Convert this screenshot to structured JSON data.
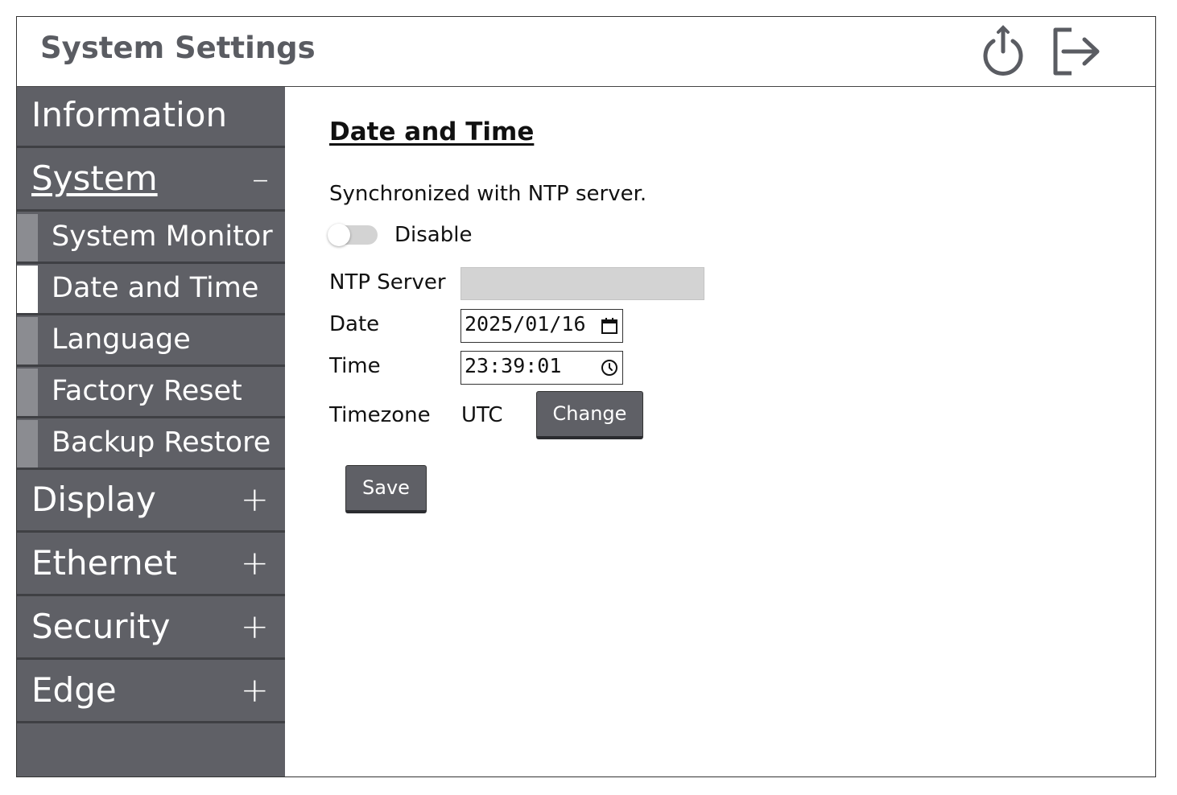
{
  "header": {
    "title": "System Settings",
    "icons": [
      "power-icon",
      "logout-icon"
    ]
  },
  "sidebar": {
    "items": [
      {
        "label": "Information"
      },
      {
        "label": "System",
        "sign": "–",
        "expanded": true,
        "children": [
          {
            "label": "System Monitor"
          },
          {
            "label": "Date and Time",
            "active": true
          },
          {
            "label": "Language"
          },
          {
            "label": "Factory Reset"
          },
          {
            "label": "Backup Restore"
          }
        ]
      },
      {
        "label": "Display",
        "sign": "+"
      },
      {
        "label": "Ethernet",
        "sign": "+"
      },
      {
        "label": "Security",
        "sign": "+"
      },
      {
        "label": "Edge",
        "sign": "+"
      }
    ]
  },
  "main": {
    "title": "Date and Time",
    "sync_text": "Synchronized with NTP server.",
    "ntp_toggle": {
      "label": "Disable",
      "on": false
    },
    "fields": {
      "ntp_server_label": "NTP Server",
      "ntp_server_value": "",
      "date_label": "Date",
      "date_value": "2025/01/16",
      "time_label": "Time",
      "time_value": "23:39:01",
      "timezone_label": "Timezone",
      "timezone_value": "UTC"
    },
    "change_label": "Change",
    "save_label": "Save"
  },
  "colors": {
    "sidebar_bg": "#5f6066",
    "sub_indent": "#8b8c91",
    "button_bg": "#5f6066",
    "input_disabled": "#d3d3d3"
  }
}
